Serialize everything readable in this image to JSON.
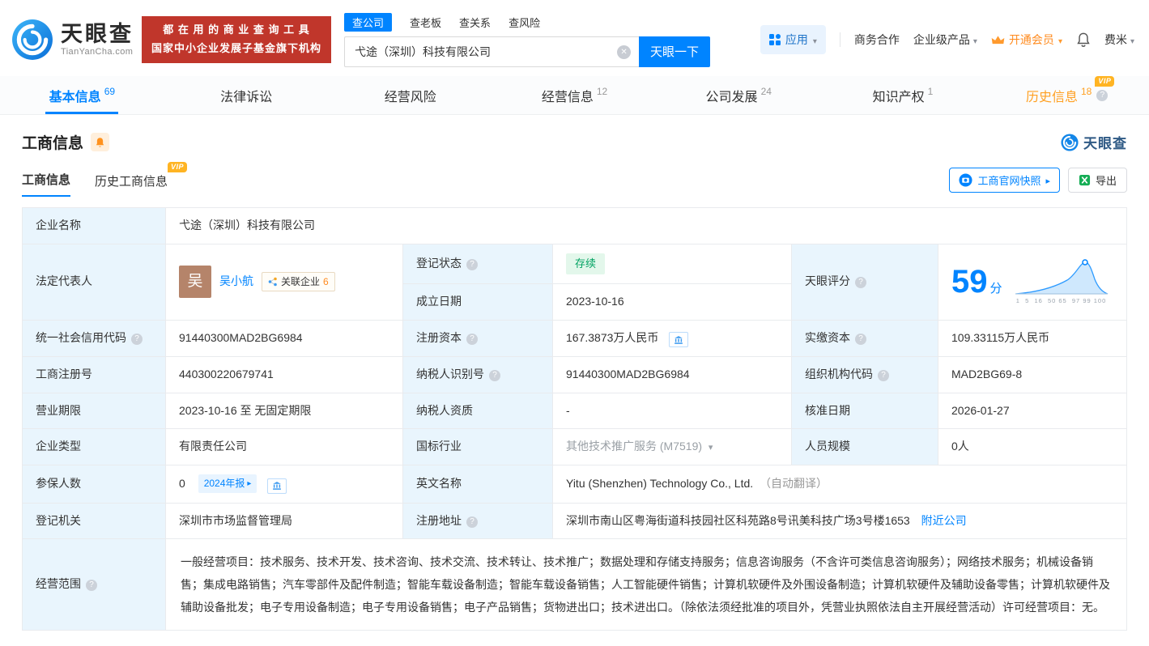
{
  "brand": {
    "name": "天眼查",
    "domain": "TianYanCha.com",
    "slogan_line1": "都 在 用 的 商 业 查 询 工 具",
    "slogan_line2": "国家中小企业发展子基金旗下机构"
  },
  "search": {
    "tabs": [
      {
        "label": "查公司"
      },
      {
        "label": "查老板"
      },
      {
        "label": "查关系"
      },
      {
        "label": "查风险"
      }
    ],
    "value": "弋途（深圳）科技有限公司",
    "button": "天眼一下"
  },
  "topnav": {
    "apps": "应用",
    "business_cooperation": "商务合作",
    "enterprise_products": "企业级产品",
    "open_vip": "开通会员",
    "username": "费米"
  },
  "badges": {
    "vip": "VIP"
  },
  "nav_tabs": [
    {
      "label": "基本信息",
      "count": "69"
    },
    {
      "label": "法律诉讼",
      "count": ""
    },
    {
      "label": "经营风险",
      "count": ""
    },
    {
      "label": "经营信息",
      "count": "12"
    },
    {
      "label": "公司发展",
      "count": "24"
    },
    {
      "label": "知识产权",
      "count": "1"
    },
    {
      "label": "历史信息",
      "count": "18"
    }
  ],
  "section": {
    "title": "工商信息",
    "brand": "天眼查",
    "sub_tab_active": "工商信息",
    "sub_tab_history": "历史工商信息",
    "snapshot_button": "工商官网快照",
    "export_button": "导出"
  },
  "score": {
    "label": "天眼评分",
    "value": "59",
    "unit": "分",
    "axis_ticks": "1  5  16  50 65  97 99 100"
  },
  "fields": {
    "company_name": {
      "label": "企业名称",
      "value": "弋途（深圳）科技有限公司"
    },
    "legal_rep": {
      "label": "法定代表人",
      "name": "吴小航",
      "avatar": "吴",
      "related_label": "关联企业",
      "related_count": "6"
    },
    "reg_status": {
      "label": "登记状态",
      "value": "存续"
    },
    "establish_date": {
      "label": "成立日期",
      "value": "2023-10-16"
    },
    "credit_code": {
      "label": "统一社会信用代码",
      "value": "91440300MAD2BG6984"
    },
    "reg_capital": {
      "label": "注册资本",
      "value": "167.3873万人民币"
    },
    "paid_capital": {
      "label": "实缴资本",
      "value": "109.33115万人民币"
    },
    "reg_no": {
      "label": "工商注册号",
      "value": "440300220679741"
    },
    "taxpayer_no": {
      "label": "纳税人识别号",
      "value": "91440300MAD2BG6984"
    },
    "org_code": {
      "label": "组织机构代码",
      "value": "MAD2BG69-8"
    },
    "business_term": {
      "label": "营业期限",
      "value": "2023-10-16 至 无固定期限"
    },
    "taxpayer_quality": {
      "label": "纳税人资质",
      "value": "-"
    },
    "approve_date": {
      "label": "核准日期",
      "value": "2026-01-27"
    },
    "company_type": {
      "label": "企业类型",
      "value": "有限责任公司"
    },
    "industry": {
      "label": "国标行业",
      "value": "其他技术推广服务",
      "code": "(M7519)"
    },
    "staff_size": {
      "label": "人员规模",
      "value": "0人"
    },
    "insured_count": {
      "label": "参保人数",
      "value": "0",
      "report": "2024年报"
    },
    "english_name": {
      "label": "英文名称",
      "value": "Yitu (Shenzhen) Technology Co., Ltd.",
      "note": "（自动翻译）"
    },
    "reg_authority": {
      "label": "登记机关",
      "value": "深圳市市场监督管理局"
    },
    "reg_address": {
      "label": "注册地址",
      "value": "深圳市南山区粤海街道科技园社区科苑路8号讯美科技广场3号楼1653",
      "nearby_link": "附近公司"
    },
    "business_scope": {
      "label": "经营范围",
      "value": "一般经营项目：技术服务、技术开发、技术咨询、技术交流、技术转让、技术推广；数据处理和存储支持服务；信息咨询服务（不含许可类信息咨询服务）；网络技术服务；机械设备销售；集成电路销售；汽车零部件及配件制造；智能车载设备制造；智能车载设备销售；人工智能硬件销售；计算机软硬件及外围设备制造；计算机软硬件及辅助设备零售；计算机软硬件及辅助设备批发；电子专用设备制造；电子专用设备销售；电子产品销售；货物进出口；技术进出口。（除依法须经批准的项目外，凭营业执照依法自主开展经营活动）许可经营项目：无。"
    }
  },
  "colors": {
    "accent": "#0084ff",
    "brand_red": "#c0362b",
    "vip_orange": "#ff9a2e",
    "status_green": "#00a261"
  }
}
